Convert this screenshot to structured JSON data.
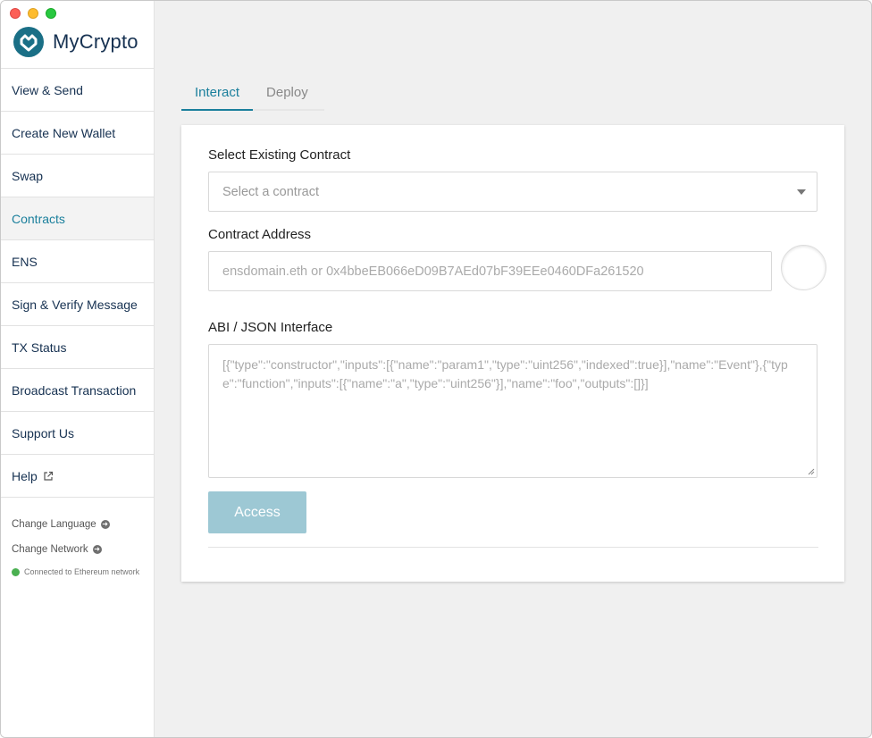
{
  "app": {
    "name": "MyCrypto"
  },
  "sidebar": {
    "items": [
      {
        "label": "View & Send"
      },
      {
        "label": "Create New Wallet"
      },
      {
        "label": "Swap"
      },
      {
        "label": "Contracts",
        "active": true
      },
      {
        "label": "ENS"
      },
      {
        "label": "Sign & Verify Message"
      },
      {
        "label": "TX Status"
      },
      {
        "label": "Broadcast Transaction"
      },
      {
        "label": "Support Us"
      },
      {
        "label": "Help",
        "icon": "external-link-icon"
      }
    ],
    "change_language": "Change Language",
    "change_network": "Change Network",
    "network_status": "Connected to Ethereum network"
  },
  "tabs": [
    {
      "label": "Interact",
      "active": true
    },
    {
      "label": "Deploy"
    }
  ],
  "form": {
    "select_label": "Select Existing Contract",
    "select_placeholder": "Select a contract",
    "address_label": "Contract Address",
    "address_placeholder": "ensdomain.eth or 0x4bbeEB066eD09B7AEd07bF39EEe0460DFa261520",
    "abi_label": "ABI / JSON Interface",
    "abi_placeholder": "[{\"type\":\"constructor\",\"inputs\":[{\"name\":\"param1\",\"type\":\"uint256\",\"indexed\":true}],\"name\":\"Event\"},{\"type\":\"function\",\"inputs\":[{\"name\":\"a\",\"type\":\"uint256\"}],\"name\":\"foo\",\"outputs\":[]}]",
    "access_button": "Access"
  },
  "colors": {
    "accent": "#1a7f9c",
    "button": "#9dc8d4",
    "brand": "#163151",
    "online": "#4ab051"
  }
}
